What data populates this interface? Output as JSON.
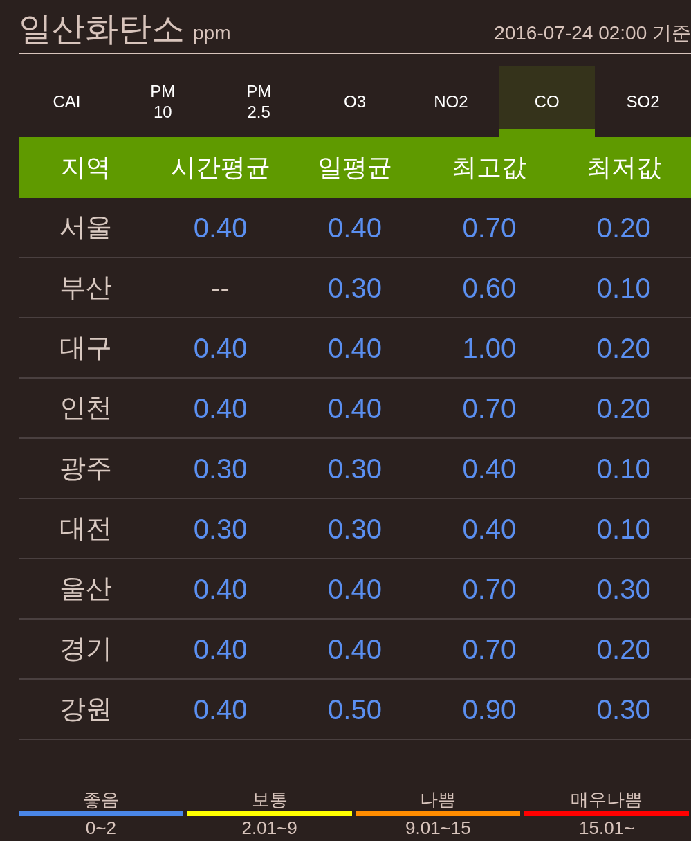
{
  "header": {
    "title": "일산화탄소",
    "unit": "ppm",
    "timestamp": "2016-07-24 02:00 기준"
  },
  "tabs": [
    {
      "lines": [
        "CAI"
      ],
      "selected": false
    },
    {
      "lines": [
        "PM",
        "10"
      ],
      "selected": false
    },
    {
      "lines": [
        "PM",
        "2.5"
      ],
      "selected": false
    },
    {
      "lines": [
        "O3"
      ],
      "selected": false
    },
    {
      "lines": [
        "NO2"
      ],
      "selected": false
    },
    {
      "lines": [
        "CO"
      ],
      "selected": true
    },
    {
      "lines": [
        "SO2"
      ],
      "selected": false
    }
  ],
  "table": {
    "columns": [
      "지역",
      "시간평균",
      "일평균",
      "최고값",
      "최저값"
    ],
    "rows": [
      [
        {
          "text": "서울",
          "kind": "region"
        },
        {
          "text": "0.40",
          "kind": "reading"
        },
        {
          "text": "0.40",
          "kind": "reading"
        },
        {
          "text": "0.70",
          "kind": "reading"
        },
        {
          "text": "0.20",
          "kind": "reading"
        }
      ],
      [
        {
          "text": "부산",
          "kind": "region"
        },
        {
          "text": "--",
          "kind": "none"
        },
        {
          "text": "0.30",
          "kind": "reading"
        },
        {
          "text": "0.60",
          "kind": "reading"
        },
        {
          "text": "0.10",
          "kind": "reading"
        }
      ],
      [
        {
          "text": "대구",
          "kind": "region"
        },
        {
          "text": "0.40",
          "kind": "reading"
        },
        {
          "text": "0.40",
          "kind": "reading"
        },
        {
          "text": "1.00",
          "kind": "reading"
        },
        {
          "text": "0.20",
          "kind": "reading"
        }
      ],
      [
        {
          "text": "인천",
          "kind": "region"
        },
        {
          "text": "0.40",
          "kind": "reading"
        },
        {
          "text": "0.40",
          "kind": "reading"
        },
        {
          "text": "0.70",
          "kind": "reading"
        },
        {
          "text": "0.20",
          "kind": "reading"
        }
      ],
      [
        {
          "text": "광주",
          "kind": "region"
        },
        {
          "text": "0.30",
          "kind": "reading"
        },
        {
          "text": "0.30",
          "kind": "reading"
        },
        {
          "text": "0.40",
          "kind": "reading"
        },
        {
          "text": "0.10",
          "kind": "reading"
        }
      ],
      [
        {
          "text": "대전",
          "kind": "region"
        },
        {
          "text": "0.30",
          "kind": "reading"
        },
        {
          "text": "0.30",
          "kind": "reading"
        },
        {
          "text": "0.40",
          "kind": "reading"
        },
        {
          "text": "0.10",
          "kind": "reading"
        }
      ],
      [
        {
          "text": "울산",
          "kind": "region"
        },
        {
          "text": "0.40",
          "kind": "reading"
        },
        {
          "text": "0.40",
          "kind": "reading"
        },
        {
          "text": "0.70",
          "kind": "reading"
        },
        {
          "text": "0.30",
          "kind": "reading"
        }
      ],
      [
        {
          "text": "경기",
          "kind": "region"
        },
        {
          "text": "0.40",
          "kind": "reading"
        },
        {
          "text": "0.40",
          "kind": "reading"
        },
        {
          "text": "0.70",
          "kind": "reading"
        },
        {
          "text": "0.20",
          "kind": "reading"
        }
      ],
      [
        {
          "text": "강원",
          "kind": "region"
        },
        {
          "text": "0.40",
          "kind": "reading"
        },
        {
          "text": "0.50",
          "kind": "reading"
        },
        {
          "text": "0.90",
          "kind": "reading"
        },
        {
          "text": "0.30",
          "kind": "reading"
        }
      ]
    ]
  },
  "legend": [
    {
      "label": "좋음",
      "color": "#4a86e8",
      "range": "0~2"
    },
    {
      "label": "보통",
      "color": "#ffff00",
      "range": "2.01~9"
    },
    {
      "label": "나쁨",
      "color": "#ff8c00",
      "range": "9.01~15"
    },
    {
      "label": "매우나쁨",
      "color": "#ff0000",
      "range": "15.01~"
    }
  ]
}
